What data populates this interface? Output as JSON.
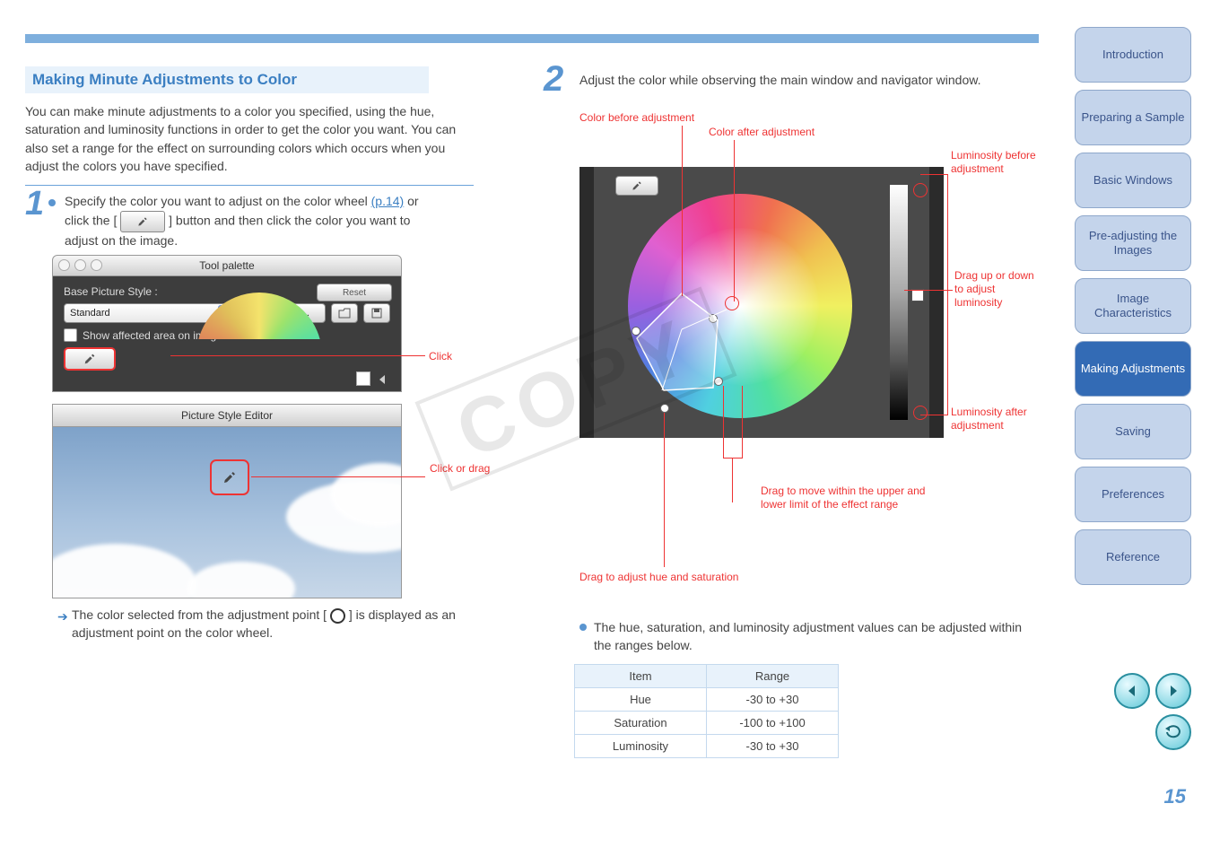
{
  "section_title": "Making Minute Adjustments to Color",
  "intro_text": "You can make minute adjustments to a color you specified, using the hue, saturation and luminosity functions in order to get the color you want. You can also set a range for the effect on surrounding colors which occurs when you adjust the colors you have specified.",
  "step1": {
    "text_before": "Specify the color you want to adjust on the color wheel ",
    "text_after": " or click the [    ] button and then click the color you want to adjust on the image.",
    "link_text": "(p.14)"
  },
  "tool_palette": {
    "window_title": "Tool palette",
    "base_label": "Base Picture Style :",
    "reset": "Reset",
    "select_value": "Standard",
    "advanced": "Advanced...",
    "show_affected": "Show affected area on images",
    "callout": "Click"
  },
  "pse": {
    "title": "Picture Style Editor",
    "callout": "Click or drag"
  },
  "result1": {
    "before": "The color selected from the adjustment point [",
    "after": "] is displayed as an adjustment point on the color wheel."
  },
  "step2": {
    "text": "Adjust the color while observing the main window and navigator window."
  },
  "wheel_annotations": {
    "before_adj": "Color before adjustment",
    "after_adj": "Color after adjustment",
    "lum_before": "Luminosity before adjustment",
    "lum_after": "Luminosity after adjustment",
    "drag_hue_sat": "Drag to adjust hue and saturation",
    "drag_effect_range": "Drag to move within the upper and lower limit of the effect range",
    "drag_lum": "Drag up or down to adjust luminosity"
  },
  "result2": "The hue, saturation, and luminosity adjustment values can be adjusted within the ranges below.",
  "table": {
    "h_item": "Item",
    "h_range": "Range",
    "rows": [
      {
        "item": "Hue",
        "range": "-30 to +30"
      },
      {
        "item": "Saturation",
        "range": "-100 to +100"
      },
      {
        "item": "Luminosity",
        "range": "-30 to +30"
      }
    ]
  },
  "sidebar": [
    {
      "label": "Introduction",
      "active": false
    },
    {
      "label": "Preparing a Sample",
      "active": false
    },
    {
      "label": "Basic Windows",
      "active": false
    },
    {
      "label": "Pre-adjusting the Images",
      "active": false
    },
    {
      "label": "Image Characteristics",
      "active": false
    },
    {
      "label": "Making Adjustments",
      "active": true
    },
    {
      "label": "Saving",
      "active": false
    },
    {
      "label": "Preferences",
      "active": false
    },
    {
      "label": "Reference",
      "active": false
    }
  ],
  "watermark": "COPY",
  "page_number": "15"
}
